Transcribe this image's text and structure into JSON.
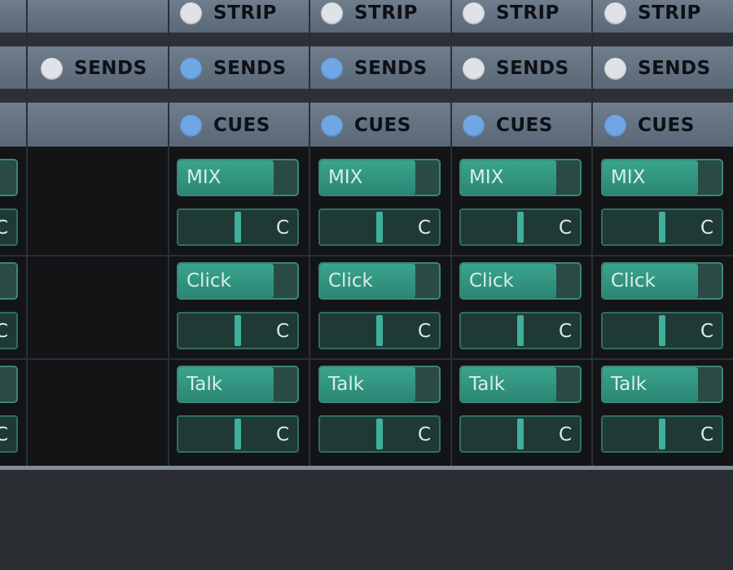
{
  "toggle_rows": {
    "strip": {
      "label": "STRIP",
      "states": [
        false,
        false,
        false,
        false
      ]
    },
    "sends": {
      "label": "SENDS",
      "states": [
        false,
        true,
        true,
        false,
        false
      ]
    },
    "cues": {
      "label": "CUES",
      "states": [
        true,
        true,
        true,
        true
      ]
    }
  },
  "send_rows": [
    {
      "name": "MIX",
      "level": 0.78,
      "pan": "C"
    },
    {
      "name": "Click",
      "level": 0.78,
      "pan": "C"
    },
    {
      "name": "Talk",
      "level": 0.78,
      "pan": "C"
    }
  ],
  "colors": {
    "send_fill": "#3aa48d",
    "toggle_active": "#6fa6e4",
    "toggle_inactive": "#dfe3e8",
    "header_bg": "#6f7d8c",
    "panel_bg": "#131416"
  },
  "icons": {
    "toggle": "radio-dot-icon",
    "pan_handle": "pan-slider-handle"
  }
}
